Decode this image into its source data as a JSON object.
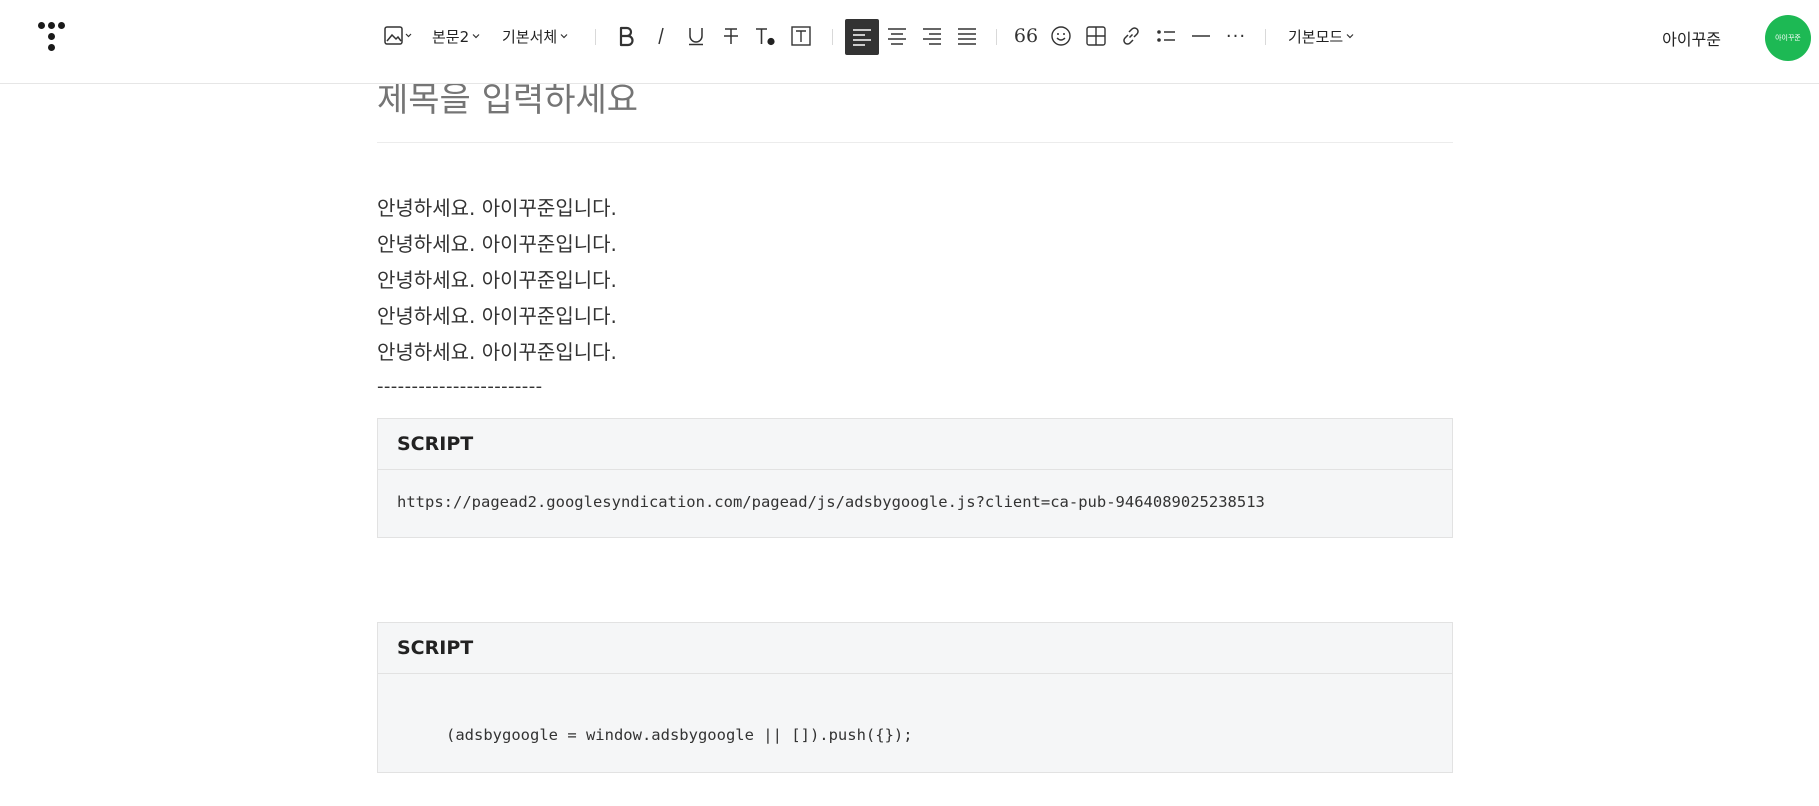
{
  "toolbar": {
    "style_dropdown": "본문2",
    "font_dropdown": "기본서체",
    "mode_dropdown": "기본모드",
    "quote_symbol": "66",
    "more_symbol": "···"
  },
  "user": {
    "name": "아이꾸준",
    "avatar_text": "아이꾸준"
  },
  "editor": {
    "title_placeholder": "제목을 입력하세요",
    "body_lines": [
      "안녕하세요. 아이꾸준입니다.",
      "안녕하세요. 아이꾸준입니다.",
      "안녕하세요. 아이꾸준입니다.",
      "안녕하세요. 아이꾸준입니다.",
      "안녕하세요. 아이꾸준입니다."
    ],
    "separator": "------------------------",
    "script_blocks": [
      {
        "label": "SCRIPT",
        "code": "https://pagead2.googlesyndication.com/pagead/js/adsbygoogle.js?client=ca-pub-9464089025238513"
      },
      {
        "label": "SCRIPT",
        "code": "(adsbygoogle = window.adsbygoogle || []).push({});"
      }
    ]
  },
  "colors": {
    "accent_green": "#1db954",
    "active_button": "#333333"
  }
}
